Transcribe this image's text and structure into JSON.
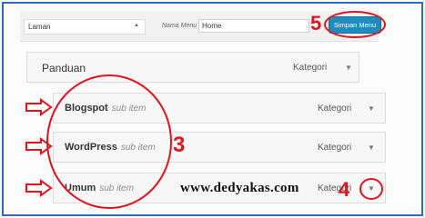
{
  "header": {
    "page_select": "Laman",
    "name_label": "Nama Menu",
    "name_value": "Home",
    "save_label": "Simpan Menu"
  },
  "menu_items": [
    {
      "title": "Panduan",
      "sub": "",
      "type": "Kategori"
    },
    {
      "title": "Blogspot",
      "sub": "sub item",
      "type": "Kategori"
    },
    {
      "title": "WordPress",
      "sub": "sub item",
      "type": "Kategori"
    },
    {
      "title": "Umum",
      "sub": "sub item",
      "type": "Kategori"
    }
  ],
  "annotations": {
    "step_save": "5",
    "step_children": "3",
    "step_caret": "4"
  },
  "watermark": "www.dedyakas.com",
  "colors": {
    "frame": "#2f6db5",
    "annotation": "#e0141e",
    "button": "#1e8cbe"
  },
  "icons": {
    "caret": "caret-down-icon",
    "arrow": "right-arrow-icon"
  }
}
